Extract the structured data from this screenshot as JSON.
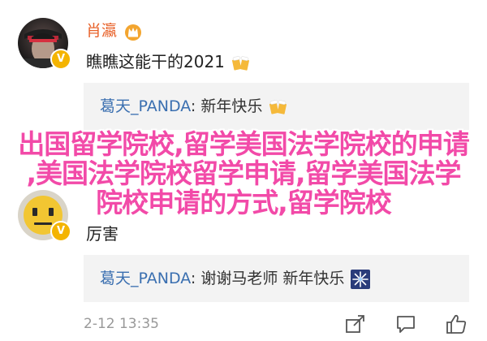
{
  "comment1": {
    "username": "肖瀛",
    "text": "瞧瞧这能干的2021",
    "reply": {
      "name": "葛天_PANDA",
      "colon": ": ",
      "text": "新年快乐"
    }
  },
  "banner": {
    "line1": "出国留学院校,留学美国法学院校的申请",
    "line2": ",美国法学院校留学申请,留学美国法学",
    "line3": "院校申请的方式,留学院校"
  },
  "comment2": {
    "text": "厉害",
    "reply": {
      "name": "葛天_PANDA",
      "colon": ": ",
      "text": "谢谢马老师 新年快乐"
    }
  },
  "footer": {
    "date": "2-12 13:35"
  },
  "icons": {
    "verified": "verified-v-badge",
    "crown": "crown-badge-icon",
    "beer": "beer-emoji-icon",
    "firework": "firework-emoji-icon",
    "share": "share-icon",
    "comment": "comment-icon",
    "like": "like-icon"
  },
  "colors": {
    "username": "#e8622a",
    "reply_name": "#3a6fb0",
    "banner": "#f24aa8",
    "verified": "#f4b400",
    "reply_bg": "#f3f3f3"
  }
}
